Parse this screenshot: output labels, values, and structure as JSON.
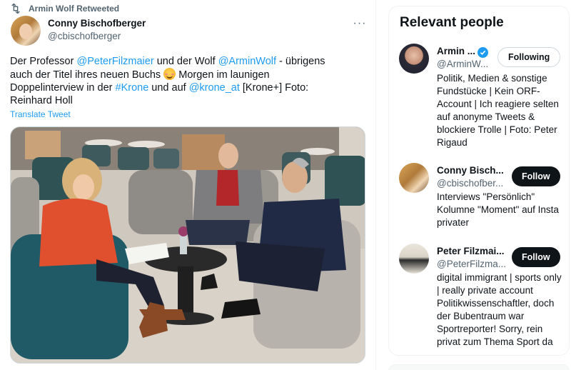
{
  "tweet": {
    "retweeted_by": "Armin Wolf Retweeted",
    "author_name": "Conny Bischofberger",
    "author_handle": "@cbischofberger",
    "more_label": "···",
    "text_parts": {
      "p1": "Der Professor ",
      "m1": "@PeterFilzmaier",
      "p2": " und der Wolf  ",
      "m2": "@ArminWolf",
      "p3": " - übrigens auch der Titel ihres neuen Buchs ",
      "p4": " Morgen im launigen Doppelinterview in der ",
      "h1": "#Krone",
      "p5": " und auf ",
      "m3": "@krone_at",
      "p6": " [Krone+] Foto: Reinhard Holl"
    },
    "translate_label": "Translate Tweet",
    "media_icon": "photo-interview"
  },
  "relevant_people": {
    "title": "Relevant people",
    "people": [
      {
        "name": "Armin ...",
        "handle": "@ArminW...",
        "verified": true,
        "button": "Following",
        "bio": "Politik, Medien & sonstige Fundstücke | Kein ORF-Account | Ich reagiere selten auf anonyme Tweets & blockiere Trolle | Foto: Peter Rigaud"
      },
      {
        "name": "Conny Bisch...",
        "handle": "@cbischofber...",
        "verified": false,
        "button": "Follow",
        "bio": "Interviews \"Persönlich\" Kolumne \"Moment\" auf Insta privater"
      },
      {
        "name": "Peter Filzmai...",
        "handle": "@PeterFilzma...",
        "verified": false,
        "button": "Follow",
        "bio": "digital immigrant | sports only | really private account Politikwissenschaftler, doch der Bubentraum war Sportreporter! Sorry, rein privat zum Thema Sport da"
      }
    ]
  },
  "colors": {
    "link": "#1d9bf0",
    "text": "#0f1419",
    "muted": "#536471",
    "follow_bg": "#0f1419"
  }
}
